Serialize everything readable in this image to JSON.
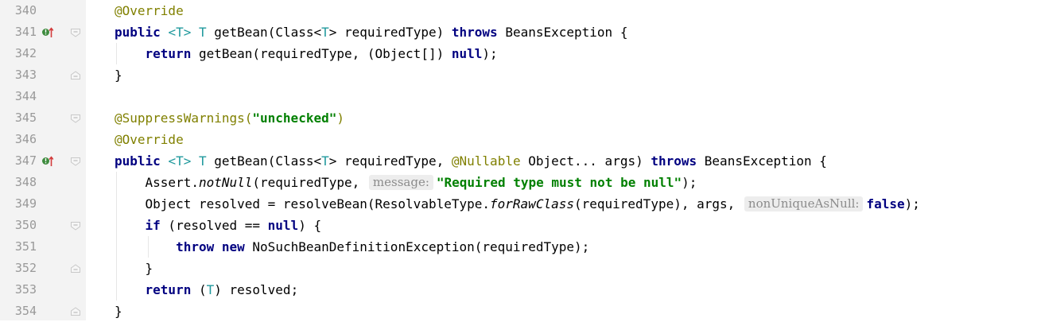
{
  "editor": {
    "language": "Java",
    "colors": {
      "keyword": "#000080",
      "annotation": "#808000",
      "string": "#008000",
      "type_param": "#20999d",
      "line_number": "#999999",
      "gutter_bg": "#f3f3f3",
      "hint_bg": "#ededed",
      "hint_fg": "#8c8c8c",
      "override_icon": "#3e8b3e",
      "override_arrow": "#d23b3b"
    },
    "line_numbers": [
      "340",
      "341",
      "342",
      "343",
      "344",
      "345",
      "346",
      "347",
      "348",
      "349",
      "350",
      "351",
      "352",
      "353",
      "354"
    ],
    "gutter_icons": [
      {
        "line": "341",
        "icon": "override-up-arrow-icon"
      },
      {
        "line": "347",
        "icon": "override-up-arrow-icon"
      }
    ],
    "fold_markers": [
      {
        "line": "341",
        "icon": "fold-open-icon"
      },
      {
        "line": "343",
        "icon": "fold-close-icon"
      },
      {
        "line": "345",
        "icon": "fold-open-icon"
      },
      {
        "line": "347",
        "icon": "fold-open-icon"
      },
      {
        "line": "350",
        "icon": "fold-open-icon"
      },
      {
        "line": "352",
        "icon": "fold-close-icon"
      },
      {
        "line": "354",
        "icon": "fold-close-icon"
      }
    ],
    "lines": {
      "l340": {
        "t1": "@Override"
      },
      "l341": {
        "t1": "public",
        "t2": " ",
        "t3": "<T>",
        "t4": " ",
        "t5": "T",
        "t6": " getBean(Class<",
        "t7": "T",
        "t8": "> requiredType) ",
        "t9": "throws",
        "t10": " BeansException {"
      },
      "l342": {
        "t1": "    ",
        "t2": "return",
        "t3": " getBean(requiredType, (Object[]) ",
        "t4": "null",
        "t5": ");"
      },
      "l343": {
        "t1": "}"
      },
      "l344": {},
      "l345": {
        "t1": "@SuppressWarnings(",
        "t2": "\"unchecked\"",
        "t3": ")"
      },
      "l346": {
        "t1": "@Override"
      },
      "l347": {
        "t1": "public",
        "t2": " ",
        "t3": "<T>",
        "t4": " ",
        "t5": "T",
        "t6": " getBean(Class<",
        "t7": "T",
        "t8": "> requiredType, ",
        "t9": "@Nullable",
        "t10": " Object... args) ",
        "t11": "throws",
        "t12": " BeansException {"
      },
      "l348": {
        "t1": "    Assert.",
        "t2": "notNull",
        "t3": "(requiredType, ",
        "hint": "message:",
        "t4": "\"Required type must not be null\"",
        "t5": ");"
      },
      "l349": {
        "t1": "    Object resolved = resolveBean(ResolvableType.",
        "t2": "forRawClass",
        "t3": "(requiredType), args, ",
        "hint": "nonUniqueAsNull:",
        "t4": "false",
        "t5": ");"
      },
      "l350": {
        "t1": "    ",
        "t2": "if",
        "t3": " (resolved == ",
        "t4": "null",
        "t5": ") {"
      },
      "l351": {
        "t1": "        ",
        "t2": "throw",
        "t3": " ",
        "t4": "new",
        "t5": " NoSuchBeanDefinitionException(requiredType);"
      },
      "l352": {
        "t1": "    }"
      },
      "l353": {
        "t1": "    ",
        "t2": "return",
        "t3": " (",
        "t4": "T",
        "t5": ") resolved;"
      },
      "l354": {
        "t1": "}"
      }
    }
  }
}
